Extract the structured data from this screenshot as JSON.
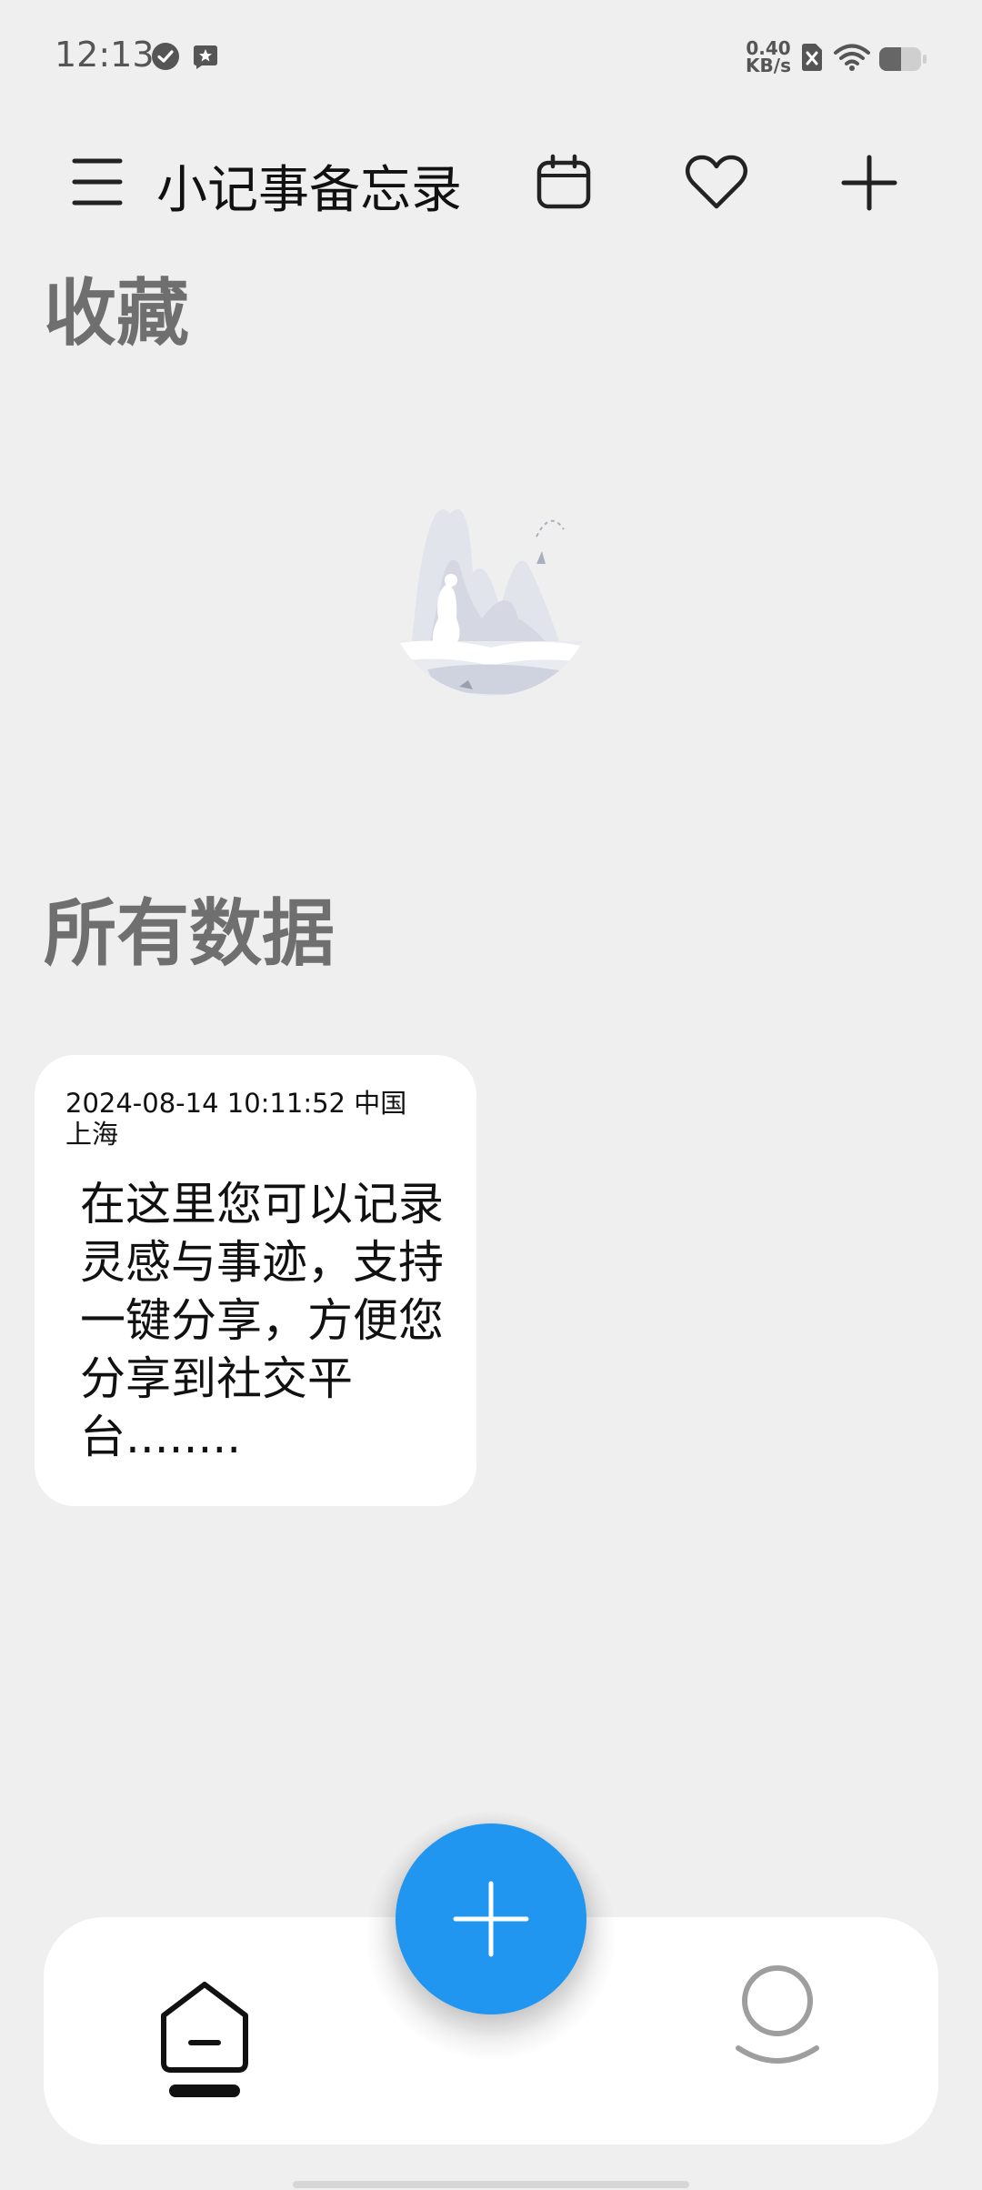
{
  "status_bar": {
    "time": "12:13",
    "net_speed_value": "0.40",
    "net_speed_unit": "KB/s",
    "icons": [
      "check-circle-icon",
      "star-notification-icon",
      "sim-x-icon",
      "wifi-icon",
      "battery-icon"
    ]
  },
  "app_bar": {
    "title": "小记事备忘录",
    "buttons": [
      "menu-icon",
      "calendar-icon",
      "heart-icon",
      "plus-icon"
    ]
  },
  "favorites": {
    "heading": "收藏"
  },
  "all_data": {
    "heading": "所有数据",
    "notes": [
      {
        "meta": "2024-08-14 10:11:52    中国 上海",
        "content": "在这里您可以记录灵感与事迹，支持一键分享，方便您分享到社交平台........"
      }
    ]
  },
  "bottom_nav": {
    "items": [
      "home-icon",
      "add-icon",
      "profile-icon"
    ],
    "active": "home"
  },
  "colors": {
    "background": "#efefef",
    "card": "#ffffff",
    "accent": "#2196f0",
    "heading": "#6f6f6f"
  }
}
